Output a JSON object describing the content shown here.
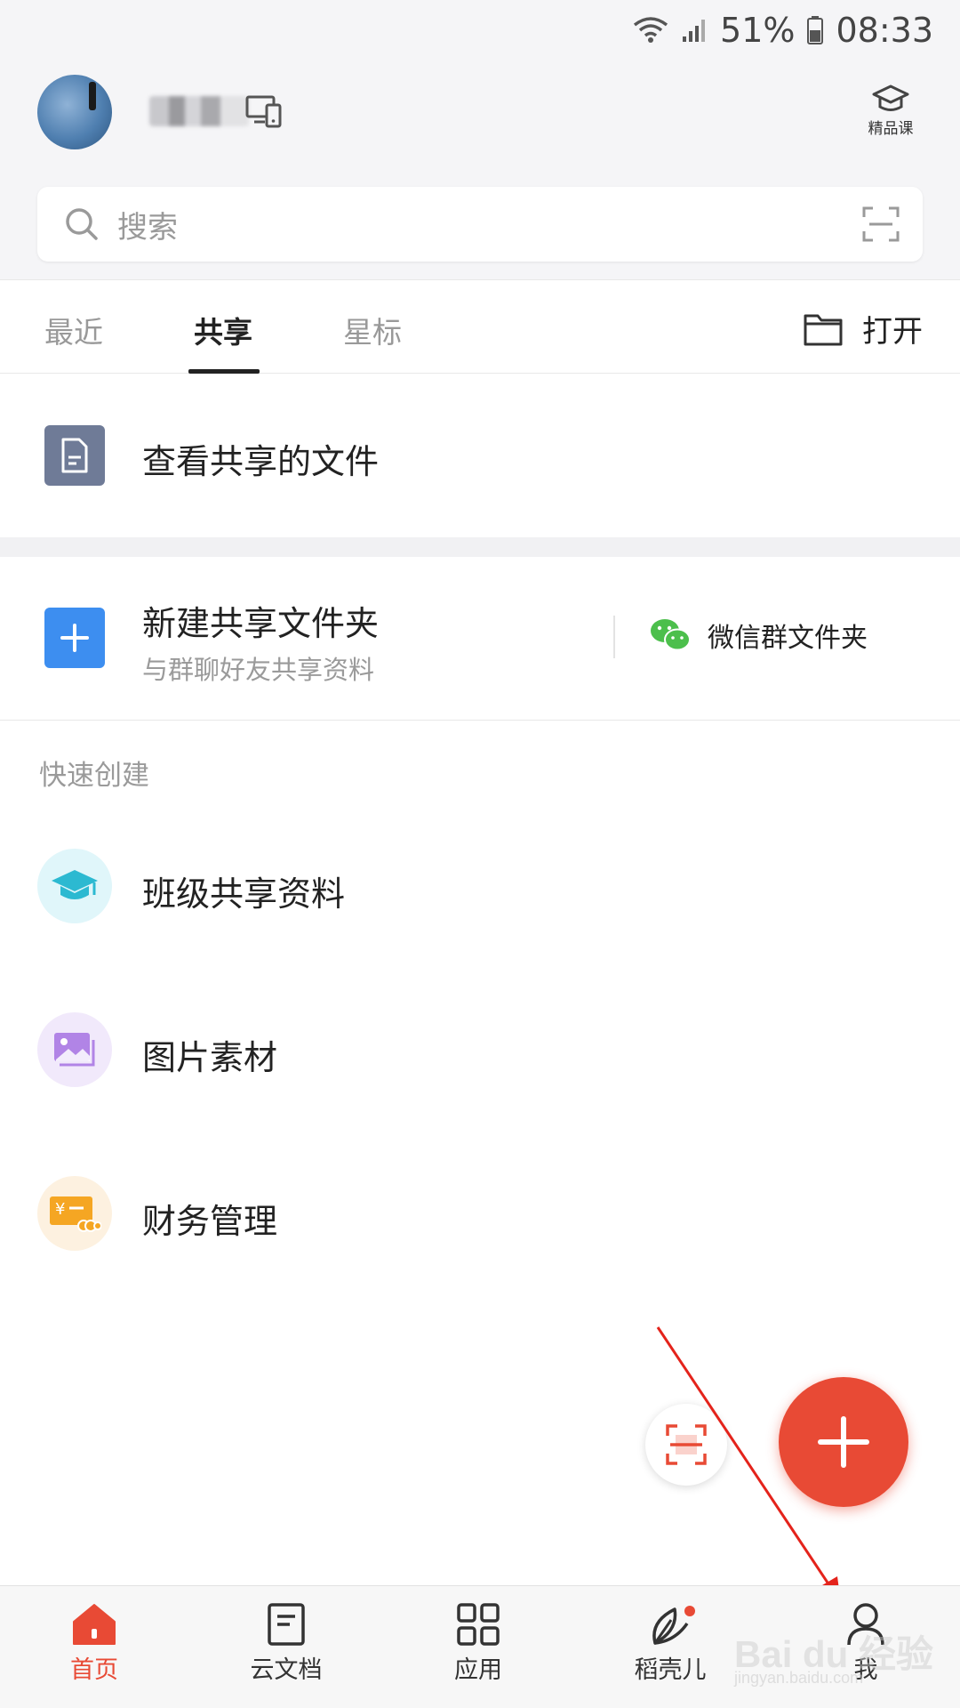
{
  "status_bar": {
    "battery": "51%",
    "time": "08:33"
  },
  "header": {
    "course_label": "精品课",
    "search_placeholder": "搜索"
  },
  "tabs": [
    {
      "label": "最近"
    },
    {
      "label": "共享"
    },
    {
      "label": "星标"
    }
  ],
  "active_tab": "共享",
  "open_label": "打开",
  "shared_files_label": "查看共享的文件",
  "new_shared_folder": {
    "title": "新建共享文件夹",
    "subtitle": "与群聊好友共享资料",
    "wechat_label": "微信群文件夹"
  },
  "quick_create": {
    "title": "快速创建",
    "items": [
      {
        "label": "班级共享资料",
        "icon": "graduation-cap-icon"
      },
      {
        "label": "图片素材",
        "icon": "image-icon"
      },
      {
        "label": "财务管理",
        "icon": "finance-card-icon"
      }
    ]
  },
  "bottom_nav": {
    "items": [
      {
        "label": "首页",
        "icon": "home-icon",
        "active": true
      },
      {
        "label": "云文档",
        "icon": "document-icon"
      },
      {
        "label": "应用",
        "icon": "apps-grid-icon"
      },
      {
        "label": "稻壳儿",
        "icon": "leaf-icon",
        "badge": true
      },
      {
        "label": "我",
        "icon": "person-icon"
      }
    ]
  },
  "watermark": {
    "brand": "Bai du 经验",
    "url": "jingyan.baidu.com"
  },
  "colors": {
    "accent": "#e84a35",
    "blue": "#3d8ef0",
    "wechat": "#4cbf4c"
  }
}
